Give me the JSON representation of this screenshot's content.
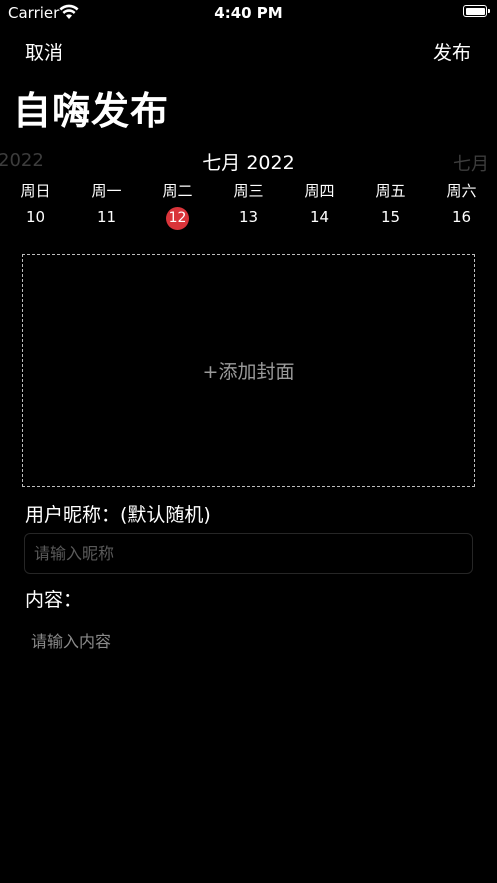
{
  "status_bar": {
    "carrier": "Carrier",
    "time": "4:40 PM"
  },
  "nav": {
    "cancel_label": "取消",
    "publish_label": "发布"
  },
  "page_title": "自嗨发布",
  "calendar": {
    "prev_label": "2022",
    "current_label": "七月 2022",
    "next_label": "七月",
    "weekdays": [
      "周日",
      "周一",
      "周二",
      "周三",
      "周四",
      "周五",
      "周六"
    ],
    "days": [
      "10",
      "11",
      "12",
      "13",
      "14",
      "15",
      "16"
    ],
    "selected_day": "12",
    "selected_color": "#d9343a"
  },
  "cover": {
    "label": "+添加封面"
  },
  "nickname": {
    "label": "用户昵称：(默认随机)",
    "placeholder": "请输入昵称",
    "value": ""
  },
  "content": {
    "label": "内容：",
    "placeholder": "请输入内容",
    "value": ""
  }
}
